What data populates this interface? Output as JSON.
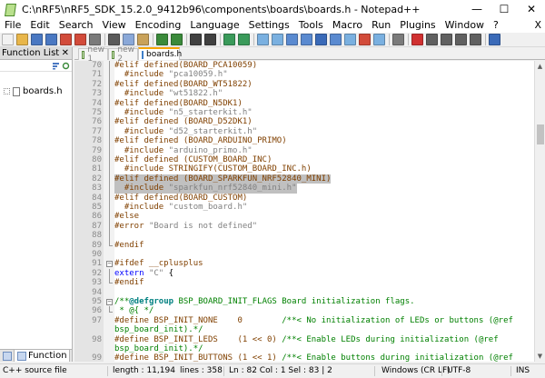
{
  "window": {
    "title": "C:\\nRF5\\nRF5_SDK_15.2.0_9412b96\\components\\boards\\boards.h - Notepad++",
    "controls": {
      "minimize": "—",
      "maximize": "☐",
      "close": "✕"
    }
  },
  "menu": {
    "items": [
      "File",
      "Edit",
      "Search",
      "View",
      "Encoding",
      "Language",
      "Settings",
      "Tools",
      "Macro",
      "Run",
      "Plugins",
      "Window",
      "?"
    ],
    "close_glyph": "X"
  },
  "toolbar": {
    "icons": [
      {
        "name": "new-file-icon",
        "color": "#f2f2f2"
      },
      {
        "name": "open-file-icon",
        "color": "#e8b64a"
      },
      {
        "name": "save-icon",
        "color": "#4a78c2"
      },
      {
        "name": "save-all-icon",
        "color": "#4a78c2"
      },
      {
        "name": "close-icon",
        "color": "#d24b3a"
      },
      {
        "name": "close-all-icon",
        "color": "#d24b3a"
      },
      {
        "name": "print-icon",
        "color": "#7a7a7a"
      },
      {
        "sep": true
      },
      {
        "name": "cut-icon",
        "color": "#5a5a5a"
      },
      {
        "name": "copy-icon",
        "color": "#8aa8d8"
      },
      {
        "name": "paste-icon",
        "color": "#c9a25a"
      },
      {
        "sep": true
      },
      {
        "name": "undo-icon",
        "color": "#3a8a3a"
      },
      {
        "name": "redo-icon",
        "color": "#3a8a3a"
      },
      {
        "sep": true
      },
      {
        "name": "find-icon",
        "color": "#404040"
      },
      {
        "name": "replace-icon",
        "color": "#404040"
      },
      {
        "sep": true
      },
      {
        "name": "zoom-in-icon",
        "color": "#3a9a5a"
      },
      {
        "name": "zoom-out-icon",
        "color": "#3a9a5a"
      },
      {
        "sep": true
      },
      {
        "name": "sync-vertical-icon",
        "color": "#7ab0e0"
      },
      {
        "name": "sync-horizontal-icon",
        "color": "#7ab0e0"
      },
      {
        "name": "word-wrap-icon",
        "color": "#5a8ad0"
      },
      {
        "name": "show-all-chars-icon",
        "color": "#5a8ad0"
      },
      {
        "name": "indent-guide-icon",
        "color": "#3a6ab8"
      },
      {
        "name": "udl-icon",
        "color": "#5a8ad0"
      },
      {
        "name": "doc-map-icon",
        "color": "#7ab0e0"
      },
      {
        "name": "function-list-icon",
        "color": "#d24b3a"
      },
      {
        "name": "folder-as-workspace-icon",
        "color": "#7ab0e0"
      },
      {
        "sep": true
      },
      {
        "name": "monitoring-icon",
        "color": "#7a7a7a"
      },
      {
        "sep": true
      },
      {
        "name": "record-macro-icon",
        "color": "#d03030"
      },
      {
        "name": "stop-macro-icon",
        "color": "#606060"
      },
      {
        "name": "play-macro-icon",
        "color": "#606060"
      },
      {
        "name": "play-multiple-icon",
        "color": "#606060"
      },
      {
        "name": "save-macro-icon",
        "color": "#606060"
      },
      {
        "sep": true
      },
      {
        "name": "spell-check-icon",
        "color": "#3a6ab8"
      }
    ]
  },
  "function_list": {
    "header": "Function List",
    "close_glyph": "✕",
    "tree_item": "boards.h",
    "bottom_tab": "Function"
  },
  "tabs": [
    {
      "label": "new 1",
      "active": false
    },
    {
      "label": "new 2",
      "active": false
    },
    {
      "label": "boards.h",
      "active": true
    }
  ],
  "editor": {
    "lines": [
      {
        "n": "70",
        "tokens": [
          [
            "pp",
            "#elif defined(BOARD_PCA10059)"
          ]
        ]
      },
      {
        "n": "71",
        "tokens": [
          [
            "pp",
            "  #include "
          ],
          [
            "str",
            "\"pca10059.h\""
          ]
        ]
      },
      {
        "n": "72",
        "tokens": [
          [
            "pp",
            "#elif defined(BOARD_WT51822)"
          ]
        ]
      },
      {
        "n": "73",
        "tokens": [
          [
            "pp",
            "  #include "
          ],
          [
            "str",
            "\"wt51822.h\""
          ]
        ]
      },
      {
        "n": "74",
        "tokens": [
          [
            "pp",
            "#elif defined(BOARD_N5DK1)"
          ]
        ]
      },
      {
        "n": "75",
        "tokens": [
          [
            "pp",
            "  #include "
          ],
          [
            "str",
            "\"n5_starterkit.h\""
          ]
        ]
      },
      {
        "n": "76",
        "tokens": [
          [
            "pp",
            "#elif defined (BOARD_D52DK1)"
          ]
        ]
      },
      {
        "n": "77",
        "tokens": [
          [
            "pp",
            "  #include "
          ],
          [
            "str",
            "\"d52_starterkit.h\""
          ]
        ]
      },
      {
        "n": "78",
        "tokens": [
          [
            "pp",
            "#elif defined (BOARD_ARDUINO_PRIMO)"
          ]
        ]
      },
      {
        "n": "79",
        "tokens": [
          [
            "pp",
            "  #include "
          ],
          [
            "str",
            "\"arduino_primo.h\""
          ]
        ]
      },
      {
        "n": "80",
        "tokens": [
          [
            "pp",
            "#elif defined (CUSTOM_BOARD_INC)"
          ]
        ]
      },
      {
        "n": "81",
        "tokens": [
          [
            "pp",
            "  #include STRINGIFY(CUSTOM_BOARD_INC.h)"
          ]
        ]
      },
      {
        "n": "82",
        "tokens": [
          [
            "pp",
            "#elif defined (BOARD_SPARKFUN_NRF52840_MINI)"
          ]
        ],
        "sel": 44
      },
      {
        "n": "83",
        "tokens": [
          [
            "pp",
            "  #include "
          ],
          [
            "str",
            "\"sparkfun_nrf52840_mini.h\""
          ]
        ],
        "sel": 37
      },
      {
        "n": "84",
        "tokens": [
          [
            "pp",
            "#elif defined(BOARD_CUSTOM)"
          ]
        ]
      },
      {
        "n": "85",
        "tokens": [
          [
            "pp",
            "  #include "
          ],
          [
            "str",
            "\"custom_board.h\""
          ]
        ]
      },
      {
        "n": "86",
        "tokens": [
          [
            "pp",
            "#else"
          ]
        ]
      },
      {
        "n": "87",
        "tokens": [
          [
            "pp",
            "#error "
          ],
          [
            "str",
            "\"Board is not defined\""
          ]
        ]
      },
      {
        "n": "88",
        "tokens": []
      },
      {
        "n": "89",
        "tokens": [
          [
            "pp",
            "#endif"
          ]
        ]
      },
      {
        "n": "90",
        "tokens": []
      },
      {
        "n": "91",
        "tokens": [
          [
            "pp",
            "#ifdef __cplusplus"
          ]
        ]
      },
      {
        "n": "92",
        "tokens": [
          [
            "kw",
            "extern "
          ],
          [
            "str",
            "\"C\" "
          ],
          [
            "plain",
            "{"
          ]
        ]
      },
      {
        "n": "93",
        "tokens": [
          [
            "pp",
            "#endif"
          ]
        ]
      },
      {
        "n": "94",
        "tokens": []
      },
      {
        "n": "95",
        "tokens": [
          [
            "cm",
            "/**"
          ],
          [
            "tag",
            "@defgroup"
          ],
          [
            "cm",
            " BSP_BOARD_INIT_FLAGS Board initialization flags."
          ]
        ]
      },
      {
        "n": "96",
        "tokens": [
          [
            "cm",
            " * @{ */"
          ]
        ]
      },
      {
        "n": "97",
        "tokens": [
          [
            "pp",
            "#define BSP_INIT_NONE    0        "
          ],
          [
            "cm",
            "/**< No initialization of LEDs or buttons (@ref"
          ]
        ]
      },
      {
        "n": "",
        "tokens": [
          [
            "cm",
            "bsp_board_init).*/"
          ]
        ]
      },
      {
        "n": "98",
        "tokens": [
          [
            "pp",
            "#define BSP_INIT_LEDS    (1 << 0) "
          ],
          [
            "cm",
            "/**< Enable LEDs during initialization (@ref"
          ]
        ]
      },
      {
        "n": "",
        "tokens": [
          [
            "cm",
            "bsp_board_init).*/"
          ]
        ]
      },
      {
        "n": "99",
        "tokens": [
          [
            "pp",
            "#define BSP_INIT_BUTTONS (1 << 1) "
          ],
          [
            "cm",
            "/**< Enable buttons during initialization (@ref"
          ]
        ]
      }
    ]
  },
  "status": {
    "file_type": "C++ source file",
    "length": "length : 11,194",
    "lines": "lines : 358",
    "position": "Ln : 82   Col : 1   Sel : 83 | 2",
    "eol": "Windows (CR LF)",
    "encoding": "UTF-8",
    "mode": "INS"
  }
}
